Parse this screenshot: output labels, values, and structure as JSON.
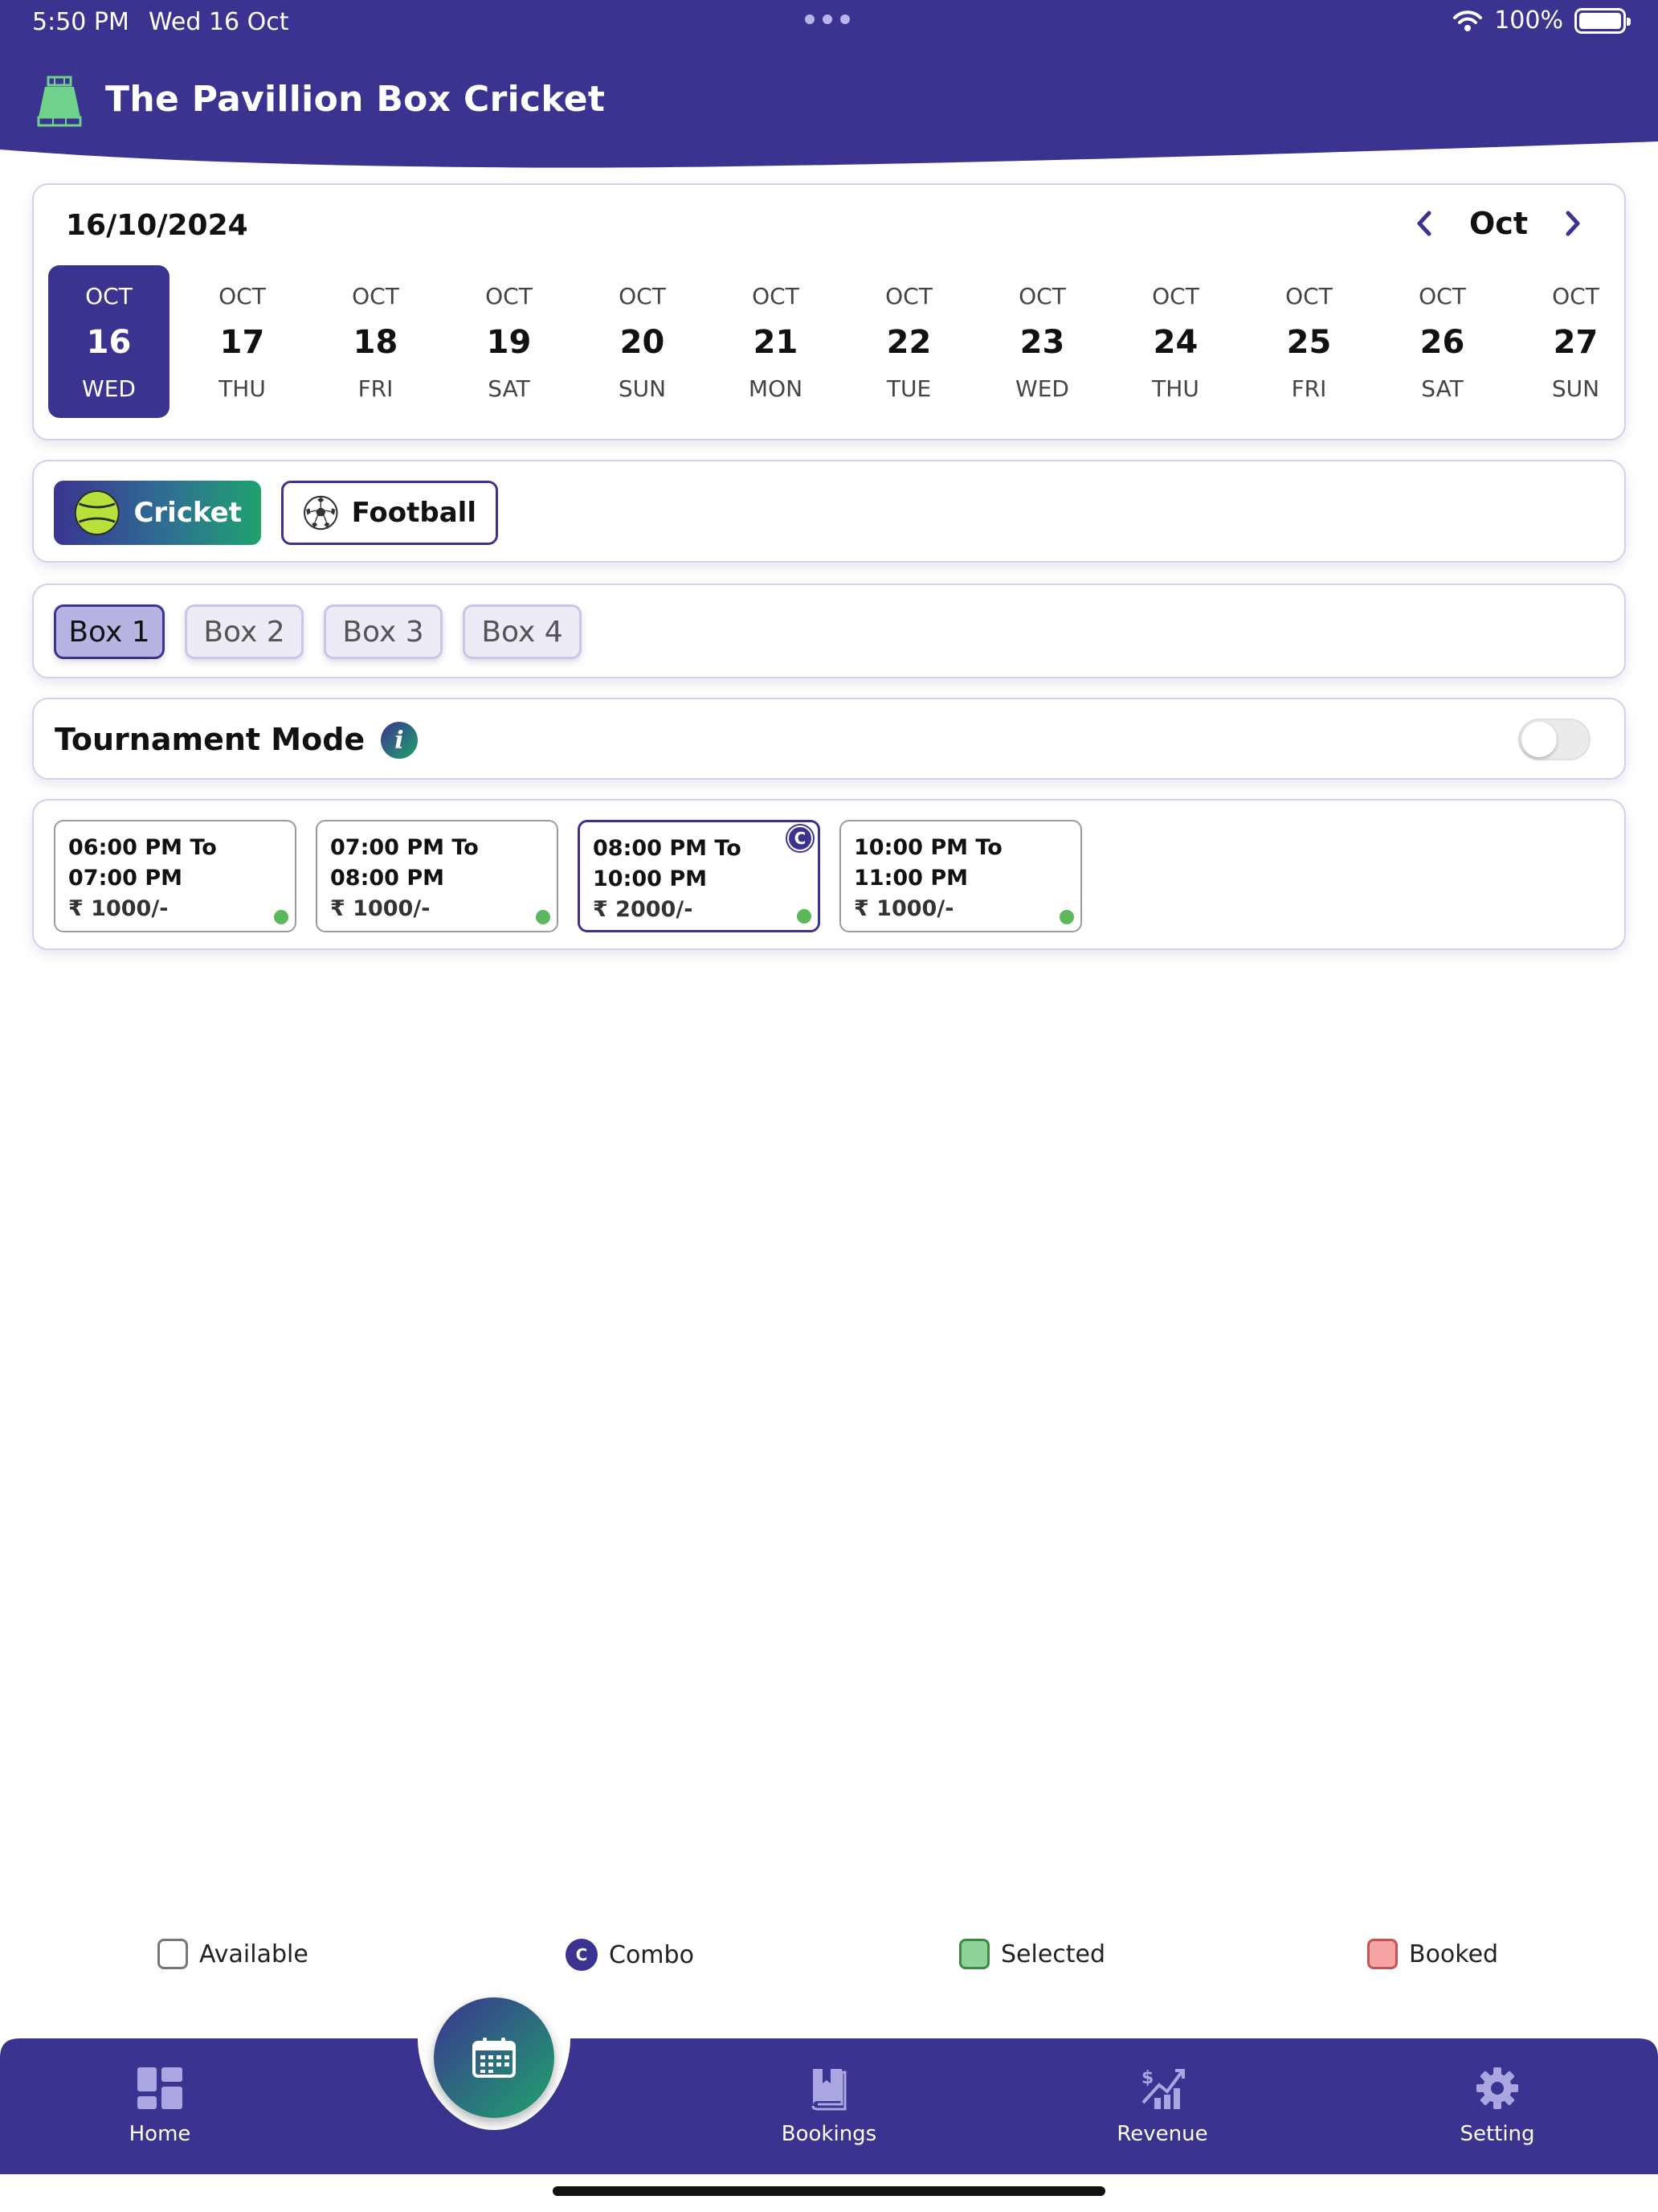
{
  "status_bar": {
    "time": "5:50 PM",
    "date": "Wed 16 Oct",
    "battery": "100%"
  },
  "app": {
    "title": "The Pavillion Box Cricket"
  },
  "calendar": {
    "selected_date": "16/10/2024",
    "month": "Oct",
    "days": [
      {
        "mon": "OCT",
        "num": "16",
        "wd": "WED",
        "active": true
      },
      {
        "mon": "OCT",
        "num": "17",
        "wd": "THU"
      },
      {
        "mon": "OCT",
        "num": "18",
        "wd": "FRI"
      },
      {
        "mon": "OCT",
        "num": "19",
        "wd": "SAT"
      },
      {
        "mon": "OCT",
        "num": "20",
        "wd": "SUN"
      },
      {
        "mon": "OCT",
        "num": "21",
        "wd": "MON"
      },
      {
        "mon": "OCT",
        "num": "22",
        "wd": "TUE"
      },
      {
        "mon": "OCT",
        "num": "23",
        "wd": "WED"
      },
      {
        "mon": "OCT",
        "num": "24",
        "wd": "THU"
      },
      {
        "mon": "OCT",
        "num": "25",
        "wd": "FRI"
      },
      {
        "mon": "OCT",
        "num": "26",
        "wd": "SAT"
      },
      {
        "mon": "OCT",
        "num": "27",
        "wd": "SUN"
      }
    ]
  },
  "sports": {
    "cricket": "Cricket",
    "football": "Football"
  },
  "boxes": [
    "Box 1",
    "Box 2",
    "Box 3",
    "Box 4"
  ],
  "tournament": {
    "label": "Tournament Mode",
    "info_icon": "i",
    "enabled": false
  },
  "slots": [
    {
      "line1": "06:00 PM To",
      "line2": "07:00 PM",
      "price": "₹ 1000/-"
    },
    {
      "line1": "07:00 PM To",
      "line2": "08:00 PM",
      "price": "₹ 1000/-"
    },
    {
      "line1": "08:00 PM To",
      "line2": "10:00 PM",
      "price": "₹ 2000/-",
      "combo": "C"
    },
    {
      "line1": "10:00 PM To",
      "line2": "11:00 PM",
      "price": "₹ 1000/-"
    }
  ],
  "legend": {
    "available": "Available",
    "combo_badge": "C",
    "combo": "Combo",
    "selected": "Selected",
    "booked": "Booked"
  },
  "nav": {
    "home": "Home",
    "bookings": "Bookings",
    "revenue": "Revenue",
    "setting": "Setting"
  },
  "colors": {
    "primary": "#3a3490",
    "accent_green": "#1fa36d",
    "available_dot": "#5cb85c"
  }
}
